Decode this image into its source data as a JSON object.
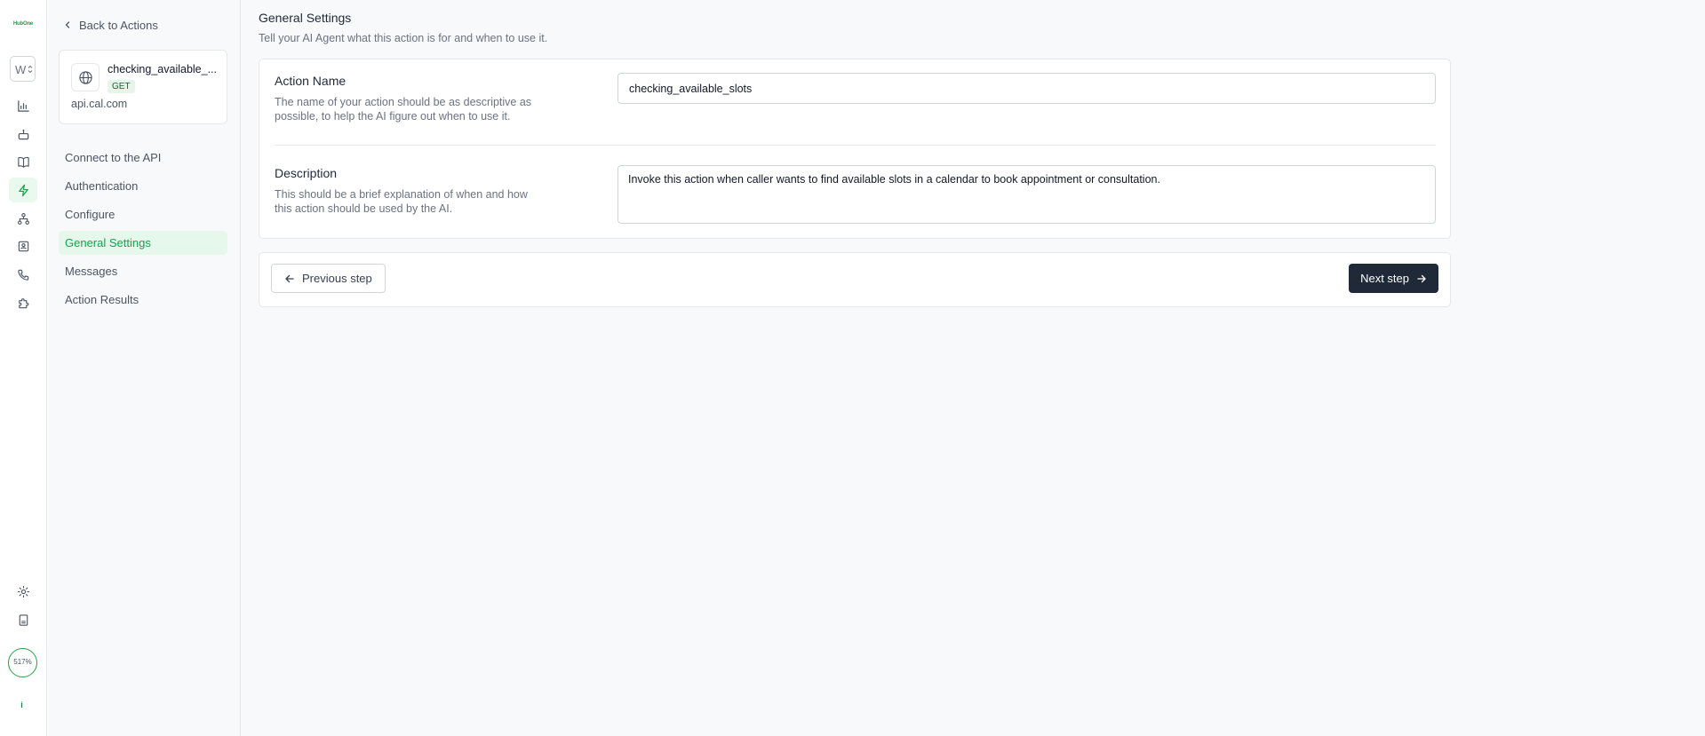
{
  "rail": {
    "logo_text": "HubOne",
    "workspace_initial": "W",
    "usage_percent": "517%",
    "info_label": "i",
    "nav_icons": [
      "bar-chart-icon",
      "robot-icon",
      "book-icon",
      "lightning-icon",
      "network-icon",
      "contact-book-icon",
      "phone-icon",
      "puzzle-icon"
    ],
    "active_nav": "lightning-icon",
    "bottom_icons": [
      "gear-icon",
      "document-icon"
    ]
  },
  "sidebar": {
    "back_label": "Back to Actions",
    "action": {
      "name": "checking_available_slots",
      "name_display": "checking_available_...",
      "method": "GET",
      "host": "api.cal.com",
      "icon": "globe-icon"
    },
    "steps": [
      {
        "label": "Connect to the API"
      },
      {
        "label": "Authentication"
      },
      {
        "label": "Configure"
      },
      {
        "label": "General Settings",
        "active": true
      },
      {
        "label": "Messages"
      },
      {
        "label": "Action Results"
      }
    ]
  },
  "main": {
    "title": "General Settings",
    "subtitle": "Tell your AI Agent what this action is for and when to use it.",
    "action_name": {
      "label": "Action Name",
      "help": "The name of your action should be as descriptive as possible, to help the AI figure out when to use it.",
      "value": "checking_available_slots"
    },
    "description": {
      "label": "Description",
      "help": "This should be a brief explanation of when and how this action should be used by the AI.",
      "value": "Invoke this action when caller wants to find available slots in a calendar to book appointment or consultation."
    },
    "prev_label": "Previous step",
    "next_label": "Next step"
  },
  "colors": {
    "accent": "#16a34a",
    "active_bg": "#e6f7ec",
    "primary_button": "#1f2937"
  }
}
